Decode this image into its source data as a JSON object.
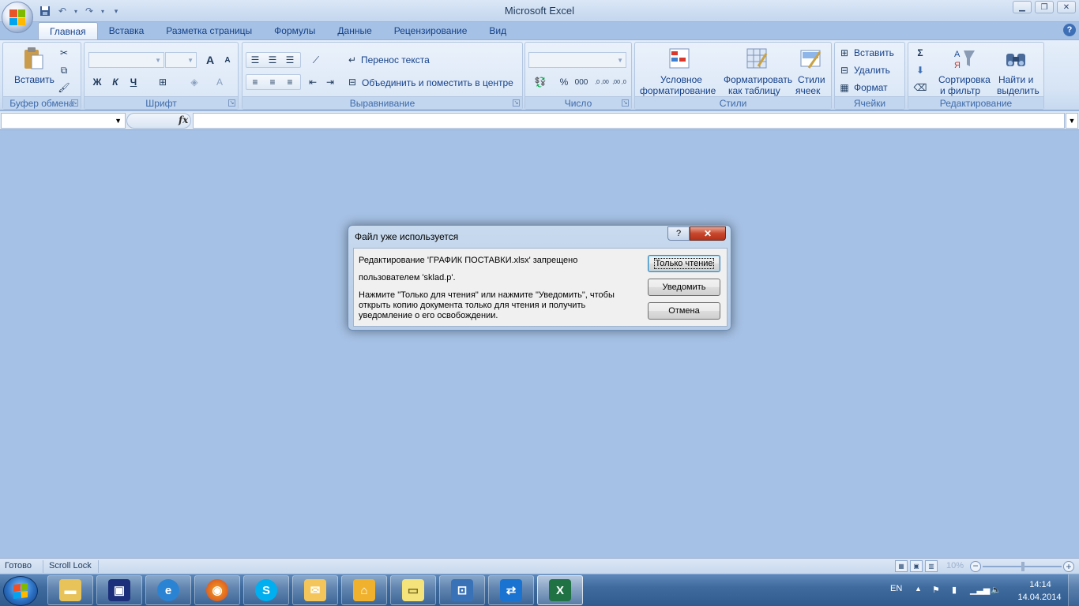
{
  "window": {
    "title": "Microsoft Excel",
    "controls": {
      "minimize": "▁",
      "maximize": "❐",
      "close": "✕"
    }
  },
  "ribbon": {
    "tabs": [
      "Главная",
      "Вставка",
      "Разметка страницы",
      "Формулы",
      "Данные",
      "Рецензирование",
      "Вид"
    ],
    "active_tab": "Главная",
    "groups": {
      "clipboard": {
        "title": "Буфер обмена",
        "paste_label": "Вставить"
      },
      "font": {
        "title": "Шрифт",
        "bold": "Ж",
        "italic": "К",
        "underline": "Ч",
        "grow": "A",
        "shrink": "A"
      },
      "alignment": {
        "title": "Выравнивание",
        "wrap_text": "Перенос текста",
        "merge_center": "Объединить и поместить в центре"
      },
      "number": {
        "title": "Число",
        "percent": "%",
        "thousands": "000",
        "inc_decimal": ",0 ,00",
        "dec_decimal": ",00 ,0"
      },
      "styles": {
        "title": "Стили",
        "conditional_1": "Условное",
        "conditional_2": "форматирование",
        "format_table_1": "Форматировать",
        "format_table_2": "как таблицу",
        "cell_styles_1": "Стили",
        "cell_styles_2": "ячеек"
      },
      "cells": {
        "title": "Ячейки",
        "insert": "Вставить",
        "delete": "Удалить",
        "format": "Формат"
      },
      "editing": {
        "title": "Редактирование",
        "sum": "Σ",
        "sort_1": "Сортировка",
        "sort_2": "и фильтр",
        "find_1": "Найти и",
        "find_2": "выделить"
      }
    }
  },
  "formula_bar": {
    "fx": "fx",
    "name_box_value": "",
    "formula_value": ""
  },
  "dialog": {
    "title": "Файл уже используется",
    "help": "?",
    "close": "✕",
    "line1": "Редактирование 'ГРАФИК ПОСТАВКИ.xlsx' запрещено",
    "line2": "пользователем 'sklad.p'.",
    "line3": "Нажмите \"Только для чтения\" или нажмите \"Уведомить\", чтобы",
    "line4": "открыть копию документа только для чтения и получить",
    "line5": "уведомление о его освобождении.",
    "btn_readonly": "Только чтение",
    "btn_notify": "Уведомить",
    "btn_cancel": "Отмена"
  },
  "status_bar": {
    "ready": "Готово",
    "scroll_lock": "Scroll Lock",
    "zoom": "10%"
  },
  "taskbar": {
    "apps": [
      "explorer",
      "save-disk",
      "internet-explorer",
      "firefox",
      "skype",
      "outlook",
      "yandex-browser",
      "sticky-notes",
      "rdp",
      "teamviewer",
      "excel"
    ],
    "lang": "EN",
    "time": "14:14",
    "date": "14.04.2014"
  },
  "colors": {
    "ribbon": "#d6e4f5",
    "workspace": "#a5c1e5",
    "dialog_close": "#c7462b",
    "taskbar": "#3f6b9f"
  }
}
